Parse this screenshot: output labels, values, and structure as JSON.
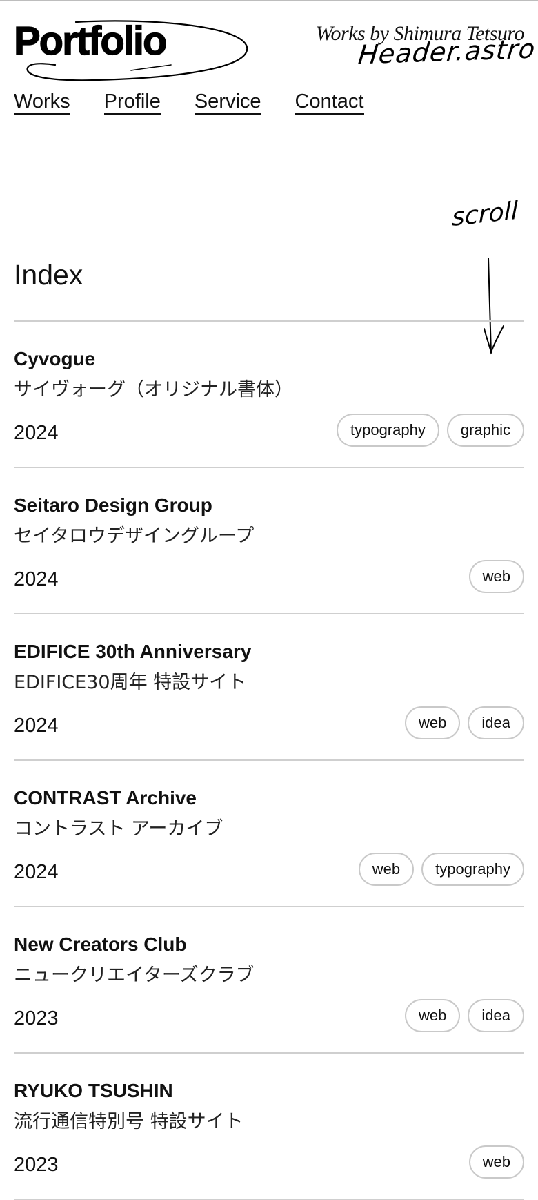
{
  "header": {
    "logo_text": "Portfolio",
    "byline": "Works by Shimura Tetsuro",
    "handwritten_note": "Header.astro"
  },
  "nav": {
    "items": [
      {
        "label": "Works"
      },
      {
        "label": "Profile"
      },
      {
        "label": "Service"
      },
      {
        "label": "Contact"
      }
    ]
  },
  "scroll_hint": {
    "label": "scroll",
    "icon": "down-arrow-icon"
  },
  "index": {
    "title": "Index",
    "items": [
      {
        "title": "Cyvogue",
        "subtitle": "サイヴォーグ（オリジナル書体）",
        "year": "2024",
        "tags": [
          "typography",
          "graphic"
        ]
      },
      {
        "title": "Seitaro Design Group",
        "subtitle": "セイタロウデザイングループ",
        "year": "2024",
        "tags": [
          "web"
        ]
      },
      {
        "title": "EDIFICE 30th Anniversary",
        "subtitle": "EDIFICE30周年 特設サイト",
        "year": "2024",
        "tags": [
          "web",
          "idea"
        ]
      },
      {
        "title": "CONTRAST Archive",
        "subtitle": "コントラスト アーカイブ",
        "year": "2024",
        "tags": [
          "web",
          "typography"
        ]
      },
      {
        "title": "New Creators Club",
        "subtitle": "ニュークリエイターズクラブ",
        "year": "2023",
        "tags": [
          "web",
          "idea"
        ]
      },
      {
        "title": "RYUKO TSUSHIN",
        "subtitle": "流行通信特別号 特設サイト",
        "year": "2023",
        "tags": [
          "web"
        ]
      }
    ]
  },
  "colors": {
    "text": "#111111",
    "divider": "#cfcfcf",
    "tag_border": "#c9c9c9",
    "background": "#ffffff"
  }
}
